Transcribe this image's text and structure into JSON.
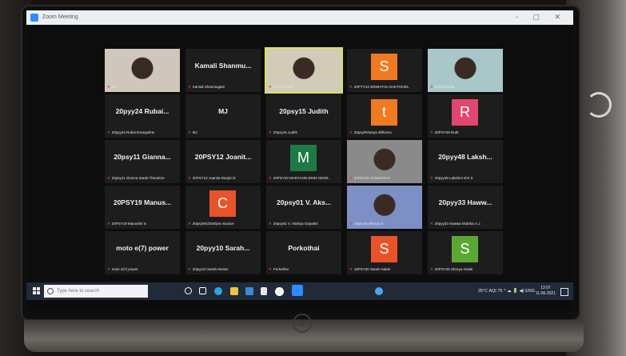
{
  "window": {
    "title": "Zoom Meeting",
    "controls": "-  ▢  ✕"
  },
  "tiles": [
    {
      "id": "t1",
      "caption": "MJ",
      "kind": "photo",
      "photo_tone": "#cfc7bb"
    },
    {
      "id": "t2",
      "big": "Kamali  Shanmu...",
      "caption": "Kamali Shanmugam",
      "kind": "name"
    },
    {
      "id": "t3",
      "caption": "Dr.D.Jumathi",
      "kind": "photo",
      "photo_tone": "#d2cbb8",
      "active": true
    },
    {
      "id": "t4",
      "letter": "S",
      "letter_color": "#f07a22",
      "caption": "20PYY13 SRIMATHA SAKTHIVEL",
      "kind": "letter"
    },
    {
      "id": "t5",
      "caption": "Ezhil Meena",
      "kind": "photo",
      "photo_tone": "#a9c7c9"
    },
    {
      "id": "t6",
      "big": "20pyy24  Rubai...",
      "caption": "20pyy24 Rubai Evangeline",
      "kind": "name"
    },
    {
      "id": "t7",
      "big": "MJ",
      "caption": "MJ",
      "kind": "name"
    },
    {
      "id": "t8",
      "big": "20psy15  Judith",
      "caption": "20psy15 Judith",
      "kind": "name"
    },
    {
      "id": "t9",
      "letter": "t",
      "letter_color": "#f07a22",
      "caption": "20psy09Tanya Williams",
      "kind": "letter"
    },
    {
      "id": "t10",
      "letter": "R",
      "letter_color": "#e0466e",
      "caption": "20PSY29 Ruth",
      "kind": "letter"
    },
    {
      "id": "t11",
      "big": "20psy11  Gianna...",
      "caption": "20psy11 Gianna Sarah Theodore",
      "kind": "name"
    },
    {
      "id": "t12",
      "big": "20PSY12  Joanit...",
      "caption": "20PSY12 Joanita Ranjini E",
      "kind": "name"
    },
    {
      "id": "t13",
      "letter": "M",
      "letter_color": "#1e7a45",
      "caption": "20PSY20 MARYANN ERIN GEOR..",
      "kind": "letter"
    },
    {
      "id": "t14",
      "caption": "20PSY40 VANSHITHA",
      "kind": "photo",
      "photo_tone": "#8a8a8a"
    },
    {
      "id": "t15",
      "big": "20pyy48  Laksh...",
      "caption": "20pyy48 Lakshmi shri S",
      "kind": "name"
    },
    {
      "id": "t16",
      "big": "20PSY19  Manus...",
      "caption": "20PSY19 Manushri S",
      "kind": "name"
    },
    {
      "id": "t17",
      "letter": "C",
      "letter_color": "#e8542a",
      "caption": "20psy09Christlynn Eunice",
      "kind": "letter"
    },
    {
      "id": "t18",
      "big": "20psy01  V.  Aks...",
      "caption": "20psy01 V. Akshya Gayathri",
      "kind": "name"
    },
    {
      "id": "t19",
      "caption": "20psy48 Shreya K",
      "kind": "photo",
      "photo_tone": "#7d8fc4"
    },
    {
      "id": "t20",
      "big": "20pyy33  Haww...",
      "caption": "20pyy33 Hawwa Muktha.A.J",
      "kind": "name"
    },
    {
      "id": "t21",
      "big": "moto e(7) power",
      "caption": "moto e(7) power",
      "kind": "name"
    },
    {
      "id": "t22",
      "big": "20pyy10  Sarah...",
      "caption": "20pyy10 Sarah Moses",
      "kind": "name"
    },
    {
      "id": "t23",
      "big": "Porkothai",
      "caption": "Porkothai",
      "kind": "name"
    },
    {
      "id": "t24",
      "letter": "S",
      "letter_color": "#e8542a",
      "caption": "19PSY30 Sarah Isabel",
      "kind": "letter"
    },
    {
      "id": "t25",
      "letter": "S",
      "letter_color": "#5aa832",
      "caption": "20PSY25 Shreya Gulati",
      "kind": "letter"
    }
  ],
  "taskbar": {
    "search_placeholder": "Type here to search",
    "tray_text": "35°C  AQI 75  ^  ☁  🔋  ◀)  ENG",
    "time": "13:07",
    "date": "11-06-2021"
  }
}
